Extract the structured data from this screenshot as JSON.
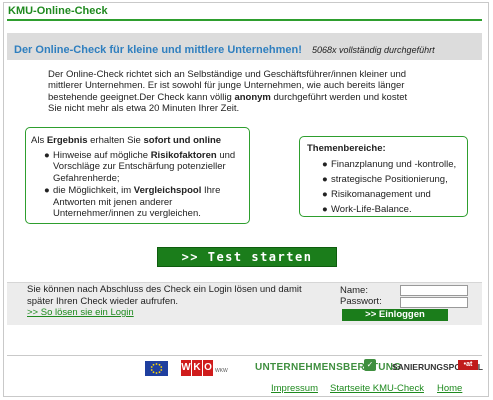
{
  "header": {
    "app_title": "KMU-Online-Check",
    "subtitle": "Der Online-Check für kleine und mittlere Unternehmen!",
    "usage_count": "5068x vollständig durchgeführt"
  },
  "intro": {
    "part1": "Der Online-Check richtet sich an Selbständige und Geschäftsführer/innen kleiner und mittlerer Unternehmen. Er ist sowohl für junge Unternehmen, wie auch bereits länger bestehende geeignet.Der Check kann völlig ",
    "bold": "anonym",
    "part2": " durchgeführt werden und kostet Sie nicht mehr als etwa 20 Minuten Ihrer Zeit."
  },
  "results_box": {
    "lead_pre": "Als ",
    "lead_bold1": "Ergebnis",
    "lead_mid": " erhalten Sie ",
    "lead_bold2": "sofort und online",
    "bullet1_pre": "Hinweise auf mögliche ",
    "bullet1_bold": "Risikofaktoren",
    "bullet1_post": " und Vorschläge zur Entschärfung potenzieller Gefahrenherde;",
    "bullet2_pre": "die Möglichkeit, im ",
    "bullet2_bold": "Vergleichspool",
    "bullet2_post": " Ihre Antworten mit jenen anderer Unternehmer/innen zu vergleichen."
  },
  "topics_box": {
    "title": "Themenbereiche:",
    "items": [
      "Finanzplanung und -kontrolle,",
      "strategische Positionierung,",
      "Risikomanagement und",
      "Work-Life-Balance."
    ]
  },
  "start_button": ">> Test starten",
  "login": {
    "text": "Sie können nach Abschluss des Check ein Login lösen und damit später Ihren Check wieder aufrufen.",
    "link": ">> So lösen sie ein Login",
    "name_label": "Name:",
    "password_label": "Passwort:",
    "name_value": "",
    "password_value": "",
    "button": ">> Einloggen"
  },
  "logos": {
    "wko_letters": [
      "W",
      "K",
      "O"
    ],
    "wko_tag": "WKW",
    "ub": "UNTERNEHMENSBERATUNG",
    "ub_mark": "✓",
    "sp": "SANIERUNGSPORTAL",
    "sp_mark": "•at"
  },
  "footer": {
    "links": [
      "Impressum",
      "Startseite KMU-Check",
      "Home"
    ]
  },
  "colors": {
    "brand_green": "#1b7d1b",
    "title_green": "#1f8a1f",
    "subtitle_blue": "#2f7fbf",
    "header_gray": "#dcdcdc",
    "eu_blue": "#1f3f9f",
    "wko_red": "#d01c1c"
  }
}
